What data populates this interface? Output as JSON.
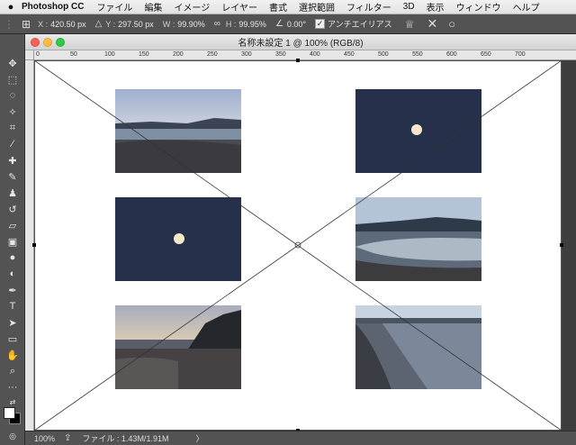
{
  "menubar": {
    "apple": "",
    "app_name": "Photoshop CC",
    "items": [
      "ファイル",
      "編集",
      "イメージ",
      "レイヤー",
      "書式",
      "選択範囲",
      "フィルター",
      "3D",
      "表示",
      "ウィンドウ",
      "ヘルプ"
    ]
  },
  "options": {
    "x_label": "X :",
    "x_value": "420.50 px",
    "y_label": "Y :",
    "y_value": "297.50 px",
    "w_label": "W :",
    "w_value": "99.90%",
    "h_label": "H :",
    "h_value": "99.95%",
    "angle_value": "0.00",
    "angle_unit": "°",
    "antialias_label": "アンチエイリアス",
    "antialias_checked": "✓"
  },
  "document": {
    "title": "名称未設定 1 @ 100% (RGB/8)"
  },
  "ruler": {
    "h_ticks": [
      "0",
      "50",
      "100",
      "150",
      "200",
      "250",
      "300",
      "350",
      "400",
      "450",
      "500",
      "550",
      "600",
      "650",
      "700"
    ]
  },
  "status": {
    "zoom": "100%",
    "file_info": "ファイル : 1.43M/1.91M",
    "arrow": "〉"
  },
  "photos": [
    {
      "name": "photo-beach-dusk",
      "scene": "beach"
    },
    {
      "name": "photo-moon-1",
      "scene": "moon"
    },
    {
      "name": "photo-moon-2",
      "scene": "moon"
    },
    {
      "name": "photo-lagoon",
      "scene": "lagoon"
    },
    {
      "name": "photo-sunset-cliff",
      "scene": "sunset"
    },
    {
      "name": "photo-shoreline",
      "scene": "shore"
    }
  ]
}
